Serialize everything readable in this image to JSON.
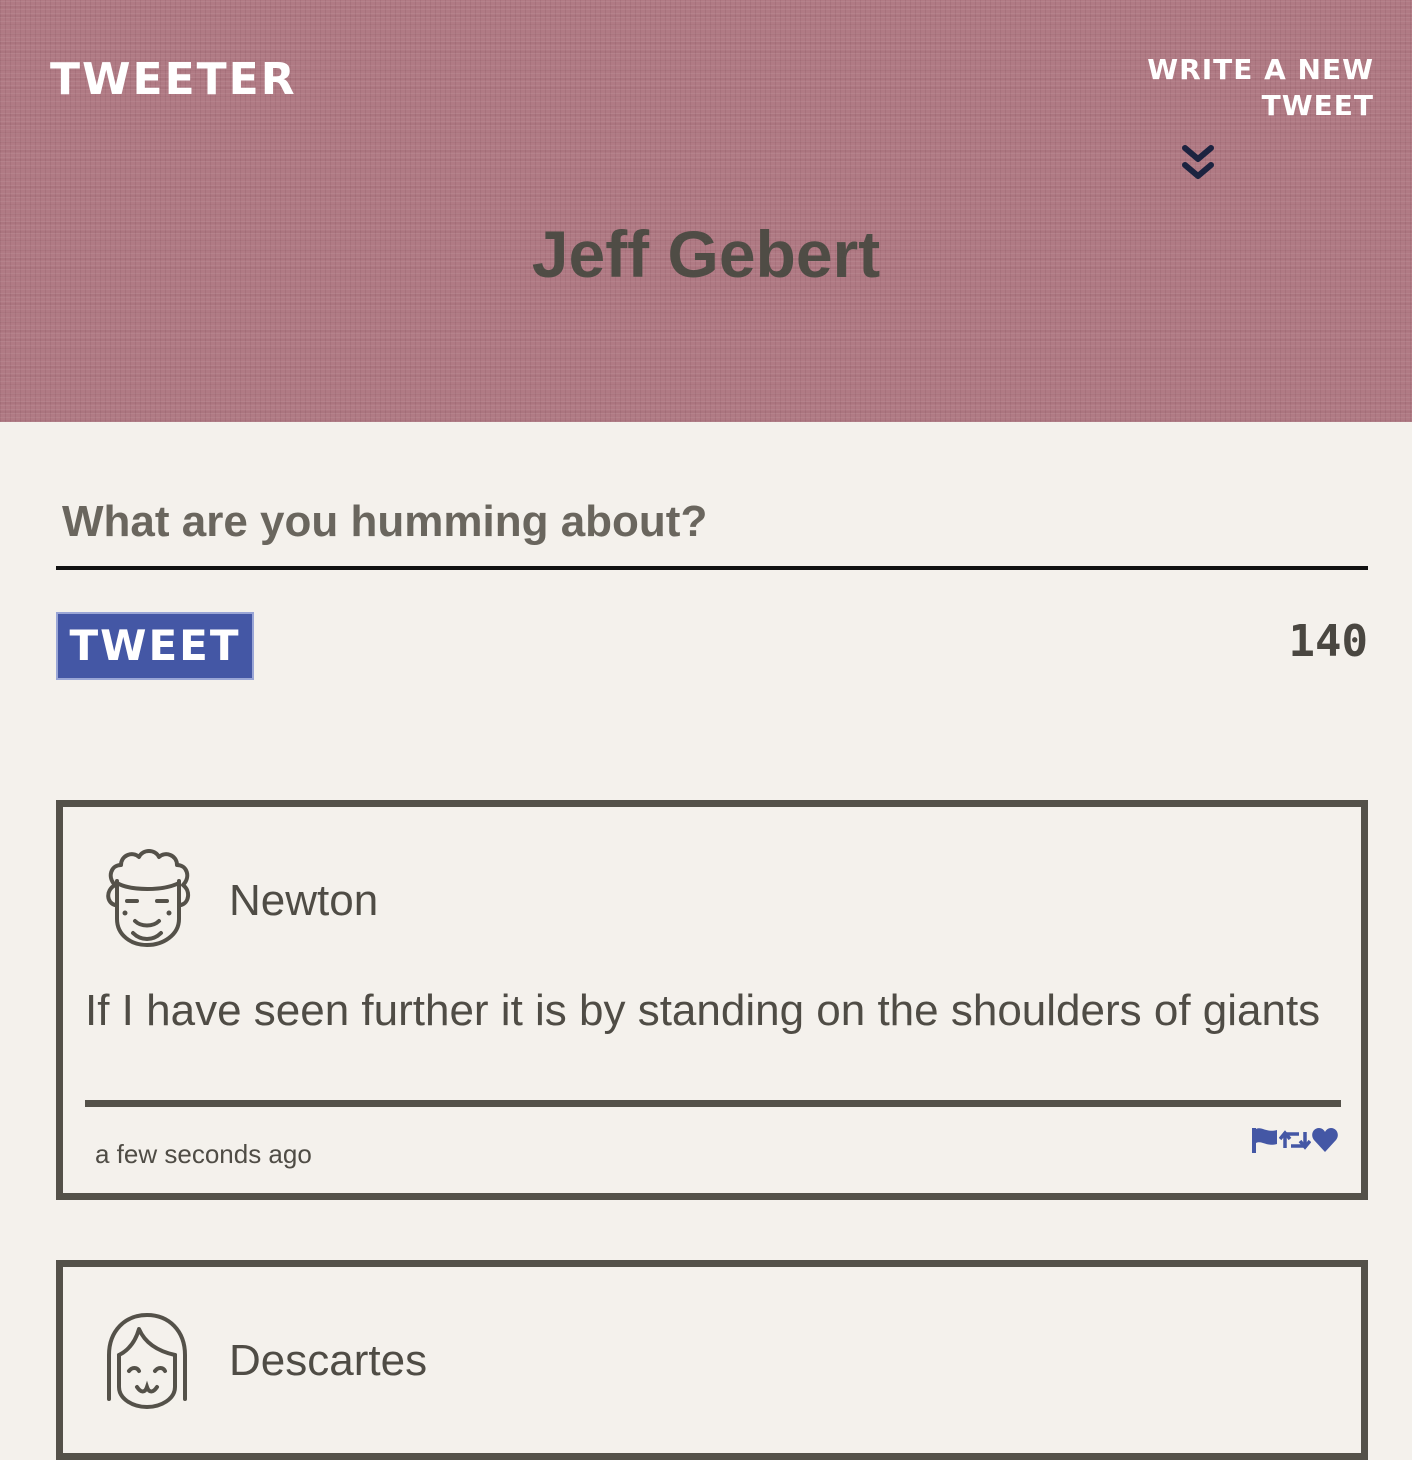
{
  "header": {
    "brand": "TWEETER",
    "compose_link": "WRITE A NEW TWEET",
    "compose_icon": "chevron-double-down-icon",
    "profile_name": "Jeff Gebert"
  },
  "composer": {
    "placeholder": "What are you humming about?",
    "value": "",
    "submit_label": "TWEET",
    "char_count": "140"
  },
  "tweets": [
    {
      "author": "Newton",
      "avatar_icon": "curly-hair-face-icon",
      "text": "If I have seen further it is by standing on the shoulders of giants",
      "timestamp": "a few seconds ago",
      "actions": [
        "flag-icon",
        "retweet-icon",
        "heart-icon"
      ]
    },
    {
      "author": "Descartes",
      "avatar_icon": "bob-hair-face-icon"
    }
  ],
  "colors": {
    "header_bg": "#b07a84",
    "page_bg": "#f4f1ec",
    "accent": "#4457a5",
    "text": "#545149",
    "chevron": "#1c2340"
  }
}
